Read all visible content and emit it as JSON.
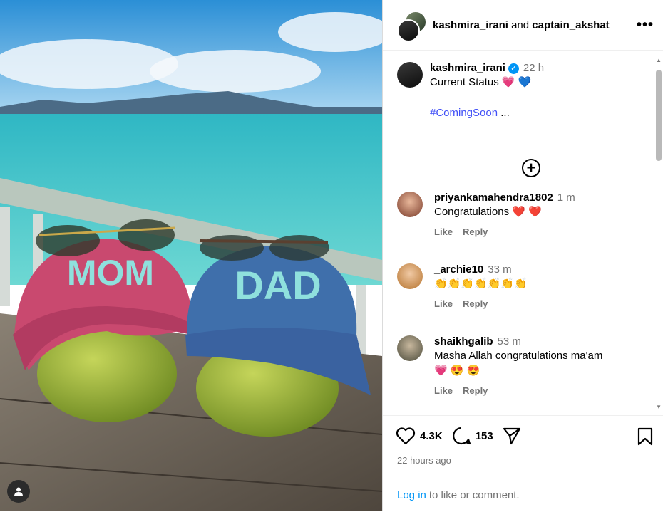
{
  "header": {
    "user1": "kashmira_irani",
    "connector": "and",
    "user2": "captain_akshat",
    "more_icon": "more-horizontal-icon"
  },
  "photo": {
    "cap_left_text": "MOM",
    "cap_right_text": "DAD"
  },
  "post": {
    "username": "kashmira_irani",
    "verified": true,
    "time": "22 h",
    "caption": "Current Status 💗 💙",
    "hashtag": "#ComingSoon",
    "hashtag_suffix": " ...",
    "expand_icon": "plus-circle-icon"
  },
  "comments": [
    {
      "username": "priyankamahendra1802",
      "time": "1 m",
      "text": "Congratulations ❤️ ❤️",
      "like": "Like",
      "reply": "Reply"
    },
    {
      "username": "_archie10",
      "time": "33 m",
      "text": "👏👏👏👏👏👏👏",
      "like": "Like",
      "reply": "Reply"
    },
    {
      "username": "shaikhgalib",
      "time": "53 m",
      "text": "Masha Allah congratulations ma'am",
      "text2": "💗 😍 😍",
      "like": "Like",
      "reply": "Reply"
    }
  ],
  "footer": {
    "likes": "4.3K",
    "comments_count": "153",
    "time_ago": "22 hours ago",
    "login_link": "Log in",
    "login_text": "to like or comment."
  },
  "colors": {
    "link": "#0095f6",
    "hashtag": "#4150f7",
    "muted": "#737373"
  }
}
